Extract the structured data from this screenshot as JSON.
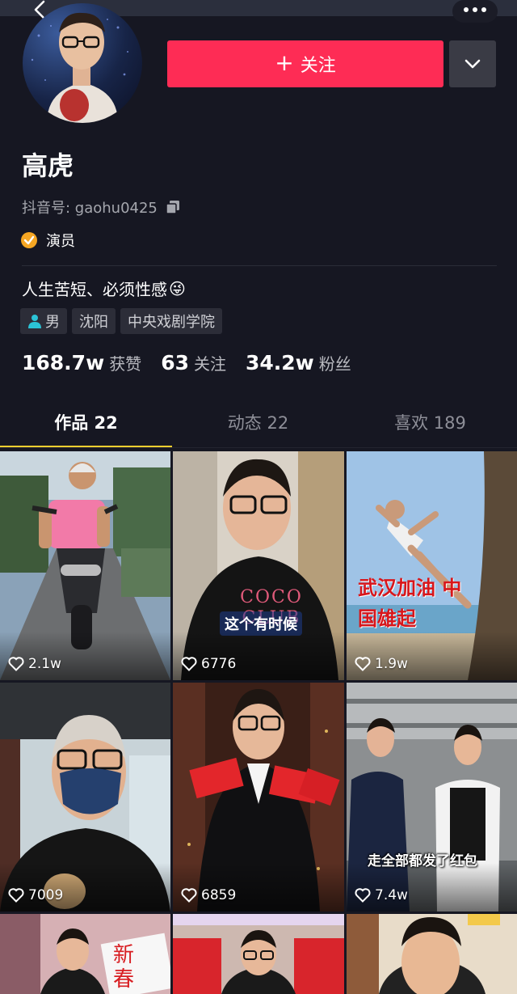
{
  "header": {
    "follow_label": "关注"
  },
  "profile": {
    "name": "高虎",
    "douyin_id": "抖音号: gaohu0425",
    "verification": "演员",
    "bio": "人生苦短、必须性感",
    "bio_emoji": "😜",
    "tags": [
      {
        "label": "男",
        "icon": "male-icon"
      },
      {
        "label": "沈阳"
      },
      {
        "label": "中央戏剧学院"
      }
    ]
  },
  "stats": [
    {
      "value": "168.7w",
      "label": "获赞"
    },
    {
      "value": "63",
      "label": "关注"
    },
    {
      "value": "34.2w",
      "label": "粉丝"
    }
  ],
  "tabs": [
    {
      "label": "作品 22",
      "active": true
    },
    {
      "label": "动态 22",
      "active": false
    },
    {
      "label": "喜欢 189",
      "active": false
    }
  ],
  "videos": [
    {
      "likes": "2.1w",
      "caption": ""
    },
    {
      "likes": "6776",
      "caption": "这个有时候",
      "shirt_text": "COCO CLUB"
    },
    {
      "likes": "1.9w",
      "caption": "武汉加油 中国雄起"
    },
    {
      "likes": "7009",
      "caption": ""
    },
    {
      "likes": "6859",
      "caption": ""
    },
    {
      "likes": "7.4w",
      "caption": "走全部都发了红包"
    },
    {
      "likes": "",
      "caption": "新 春"
    },
    {
      "likes": "",
      "caption": ""
    },
    {
      "likes": "",
      "caption": ""
    }
  ],
  "colors": {
    "background": "#161722",
    "accent": "#fe2c55",
    "tab_indicator": "#facf2f",
    "verify_badge": "#f5a623"
  }
}
